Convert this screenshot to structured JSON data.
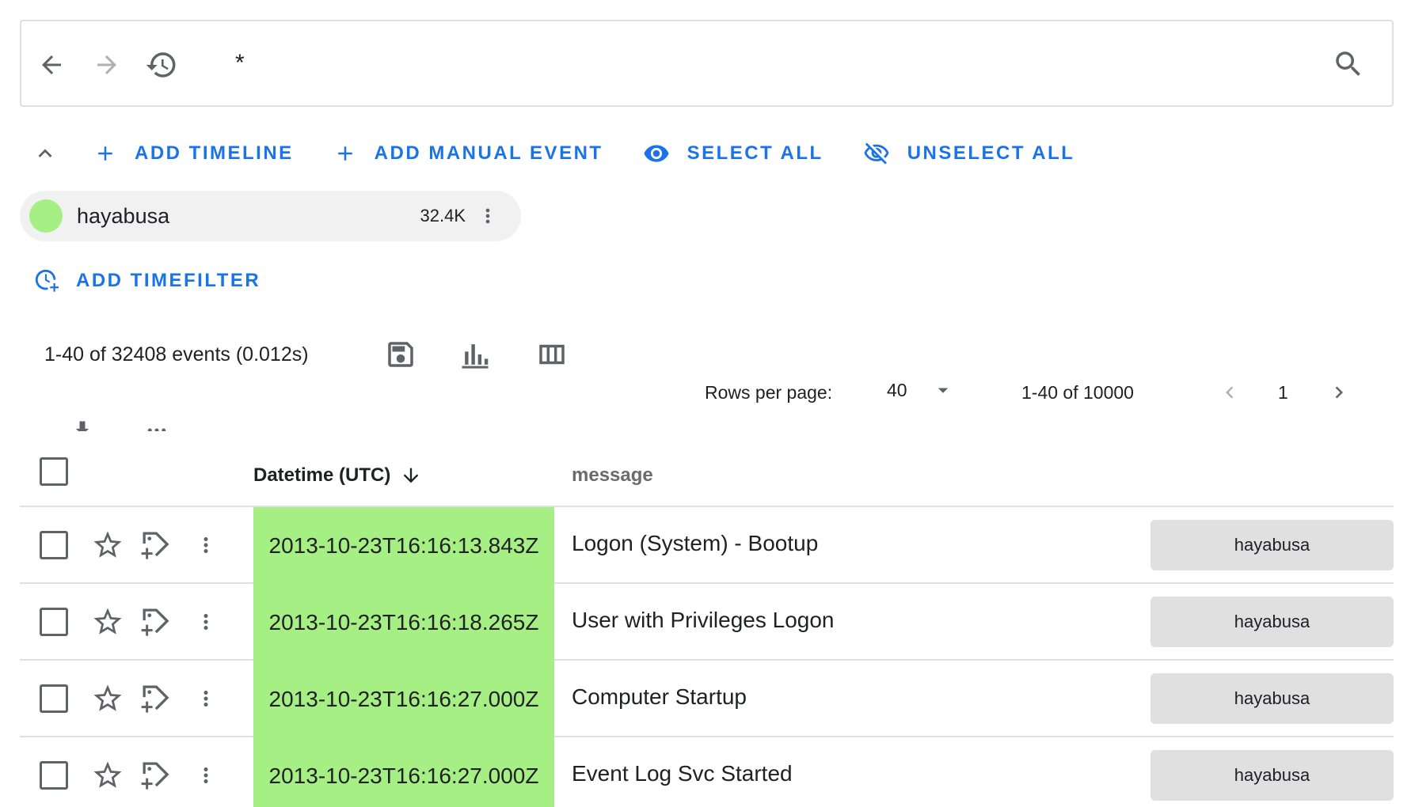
{
  "search": {
    "query": "*",
    "back_icon": "arrow-back-icon",
    "forward_icon": "arrow-forward-icon",
    "history_icon": "history-icon",
    "search_icon": "search-icon"
  },
  "actions": {
    "collapse_icon": "chevron-up-icon",
    "add_timeline": "ADD TIMELINE",
    "add_manual_event": "ADD MANUAL EVENT",
    "select_all": "SELECT ALL",
    "unselect_all": "UNSELECT ALL"
  },
  "timeline": {
    "name": "hayabusa",
    "count": "32.4K",
    "color": "#a6ef84"
  },
  "timefilter": {
    "label": "ADD TIMEFILTER"
  },
  "results": {
    "summary": "1-40 of 32408 events (0.012s)",
    "tools": [
      "save-icon",
      "bar-chart-icon",
      "columns-icon"
    ]
  },
  "pagination": {
    "rows_per_page_label": "Rows per page:",
    "rows_per_page": "40",
    "range": "1-40 of 10000",
    "page": "1"
  },
  "table": {
    "columns": {
      "datetime": "Datetime (UTC)",
      "message": "message"
    },
    "highlight_color": "#a6ef84",
    "rows": [
      {
        "datetime": "2013-10-23T16:16:13.843Z",
        "message": "Logon (System) - Bootup",
        "timeline": "hayabusa"
      },
      {
        "datetime": "2013-10-23T16:16:18.265Z",
        "message": "User with Privileges Logon",
        "timeline": "hayabusa"
      },
      {
        "datetime": "2013-10-23T16:16:27.000Z",
        "message": "Computer Startup",
        "timeline": "hayabusa"
      },
      {
        "datetime": "2013-10-23T16:16:27.000Z",
        "message": "Event Log Svc Started",
        "timeline": "hayabusa"
      }
    ]
  }
}
